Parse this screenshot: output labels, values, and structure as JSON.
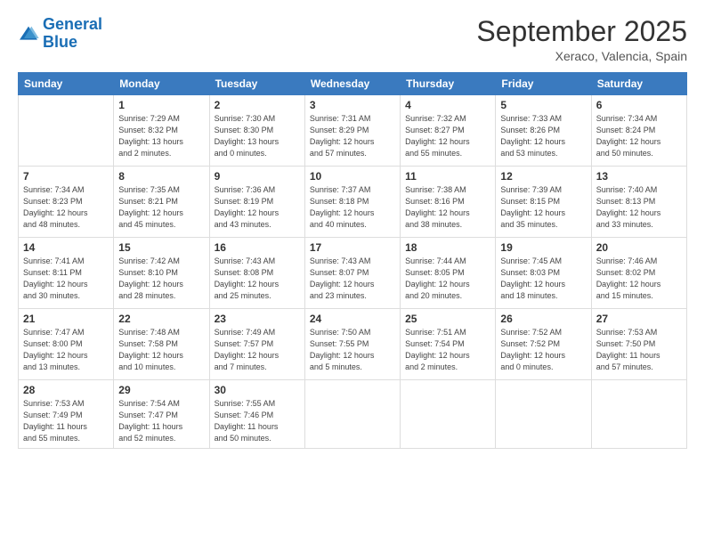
{
  "logo": {
    "line1": "General",
    "line2": "Blue"
  },
  "title": "September 2025",
  "subtitle": "Xeraco, Valencia, Spain",
  "weekdays": [
    "Sunday",
    "Monday",
    "Tuesday",
    "Wednesday",
    "Thursday",
    "Friday",
    "Saturday"
  ],
  "weeks": [
    [
      {
        "day": "",
        "info": ""
      },
      {
        "day": "1",
        "info": "Sunrise: 7:29 AM\nSunset: 8:32 PM\nDaylight: 13 hours\nand 2 minutes."
      },
      {
        "day": "2",
        "info": "Sunrise: 7:30 AM\nSunset: 8:30 PM\nDaylight: 13 hours\nand 0 minutes."
      },
      {
        "day": "3",
        "info": "Sunrise: 7:31 AM\nSunset: 8:29 PM\nDaylight: 12 hours\nand 57 minutes."
      },
      {
        "day": "4",
        "info": "Sunrise: 7:32 AM\nSunset: 8:27 PM\nDaylight: 12 hours\nand 55 minutes."
      },
      {
        "day": "5",
        "info": "Sunrise: 7:33 AM\nSunset: 8:26 PM\nDaylight: 12 hours\nand 53 minutes."
      },
      {
        "day": "6",
        "info": "Sunrise: 7:34 AM\nSunset: 8:24 PM\nDaylight: 12 hours\nand 50 minutes."
      }
    ],
    [
      {
        "day": "7",
        "info": "Sunrise: 7:34 AM\nSunset: 8:23 PM\nDaylight: 12 hours\nand 48 minutes."
      },
      {
        "day": "8",
        "info": "Sunrise: 7:35 AM\nSunset: 8:21 PM\nDaylight: 12 hours\nand 45 minutes."
      },
      {
        "day": "9",
        "info": "Sunrise: 7:36 AM\nSunset: 8:19 PM\nDaylight: 12 hours\nand 43 minutes."
      },
      {
        "day": "10",
        "info": "Sunrise: 7:37 AM\nSunset: 8:18 PM\nDaylight: 12 hours\nand 40 minutes."
      },
      {
        "day": "11",
        "info": "Sunrise: 7:38 AM\nSunset: 8:16 PM\nDaylight: 12 hours\nand 38 minutes."
      },
      {
        "day": "12",
        "info": "Sunrise: 7:39 AM\nSunset: 8:15 PM\nDaylight: 12 hours\nand 35 minutes."
      },
      {
        "day": "13",
        "info": "Sunrise: 7:40 AM\nSunset: 8:13 PM\nDaylight: 12 hours\nand 33 minutes."
      }
    ],
    [
      {
        "day": "14",
        "info": "Sunrise: 7:41 AM\nSunset: 8:11 PM\nDaylight: 12 hours\nand 30 minutes."
      },
      {
        "day": "15",
        "info": "Sunrise: 7:42 AM\nSunset: 8:10 PM\nDaylight: 12 hours\nand 28 minutes."
      },
      {
        "day": "16",
        "info": "Sunrise: 7:43 AM\nSunset: 8:08 PM\nDaylight: 12 hours\nand 25 minutes."
      },
      {
        "day": "17",
        "info": "Sunrise: 7:43 AM\nSunset: 8:07 PM\nDaylight: 12 hours\nand 23 minutes."
      },
      {
        "day": "18",
        "info": "Sunrise: 7:44 AM\nSunset: 8:05 PM\nDaylight: 12 hours\nand 20 minutes."
      },
      {
        "day": "19",
        "info": "Sunrise: 7:45 AM\nSunset: 8:03 PM\nDaylight: 12 hours\nand 18 minutes."
      },
      {
        "day": "20",
        "info": "Sunrise: 7:46 AM\nSunset: 8:02 PM\nDaylight: 12 hours\nand 15 minutes."
      }
    ],
    [
      {
        "day": "21",
        "info": "Sunrise: 7:47 AM\nSunset: 8:00 PM\nDaylight: 12 hours\nand 13 minutes."
      },
      {
        "day": "22",
        "info": "Sunrise: 7:48 AM\nSunset: 7:58 PM\nDaylight: 12 hours\nand 10 minutes."
      },
      {
        "day": "23",
        "info": "Sunrise: 7:49 AM\nSunset: 7:57 PM\nDaylight: 12 hours\nand 7 minutes."
      },
      {
        "day": "24",
        "info": "Sunrise: 7:50 AM\nSunset: 7:55 PM\nDaylight: 12 hours\nand 5 minutes."
      },
      {
        "day": "25",
        "info": "Sunrise: 7:51 AM\nSunset: 7:54 PM\nDaylight: 12 hours\nand 2 minutes."
      },
      {
        "day": "26",
        "info": "Sunrise: 7:52 AM\nSunset: 7:52 PM\nDaylight: 12 hours\nand 0 minutes."
      },
      {
        "day": "27",
        "info": "Sunrise: 7:53 AM\nSunset: 7:50 PM\nDaylight: 11 hours\nand 57 minutes."
      }
    ],
    [
      {
        "day": "28",
        "info": "Sunrise: 7:53 AM\nSunset: 7:49 PM\nDaylight: 11 hours\nand 55 minutes."
      },
      {
        "day": "29",
        "info": "Sunrise: 7:54 AM\nSunset: 7:47 PM\nDaylight: 11 hours\nand 52 minutes."
      },
      {
        "day": "30",
        "info": "Sunrise: 7:55 AM\nSunset: 7:46 PM\nDaylight: 11 hours\nand 50 minutes."
      },
      {
        "day": "",
        "info": ""
      },
      {
        "day": "",
        "info": ""
      },
      {
        "day": "",
        "info": ""
      },
      {
        "day": "",
        "info": ""
      }
    ]
  ]
}
